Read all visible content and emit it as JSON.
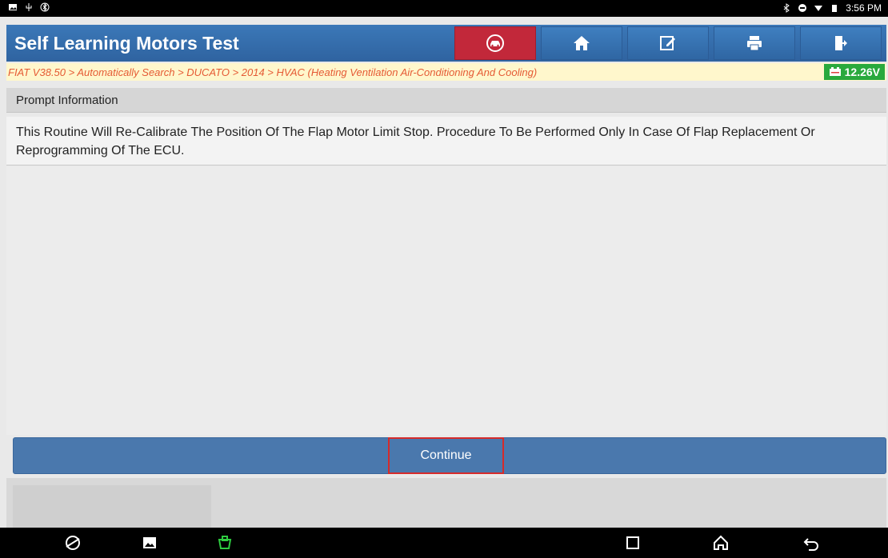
{
  "status_bar": {
    "time": "3:56 PM",
    "left_icons": [
      "image-icon",
      "usb-icon",
      "bluetooth-circle-icon"
    ],
    "right_icons": [
      "bluetooth-icon",
      "minus-circle-icon",
      "wifi-icon",
      "battery-icon"
    ]
  },
  "header": {
    "title": "Self Learning Motors Test",
    "tools": [
      "vehicle-icon",
      "home-icon",
      "edit-icon",
      "print-icon",
      "exit-icon"
    ]
  },
  "breadcrumb": {
    "text": "FIAT V38.50 > Automatically Search > DUCATO > 2014 > HVAC (Heating Ventilation Air-Conditioning And Cooling)",
    "voltage": "12.26V"
  },
  "prompt": {
    "title": "Prompt Information",
    "message": "This Routine Will Re-Calibrate The Position Of The Flap Motor Limit Stop. Procedure To Be Performed Only In Case Of Flap Replacement Or Reprogramming Of The ECU."
  },
  "actions": {
    "continue_label": "Continue"
  },
  "nav": [
    "browser-icon",
    "gallery-icon",
    "vci-icon",
    "recents-icon",
    "home-icon",
    "back-icon"
  ],
  "colors": {
    "header": "#3b78b8",
    "tool_red": "#c2283a",
    "breadcrumb_text": "#e55a34",
    "battery": "#29a93d",
    "continue_bar": "#4a78ad",
    "highlight": "#d52b2b"
  }
}
